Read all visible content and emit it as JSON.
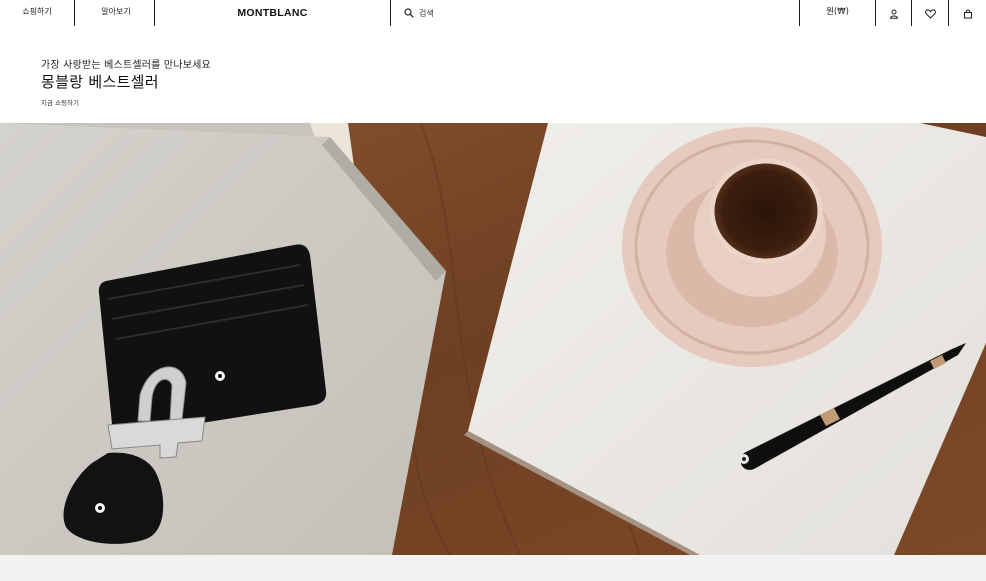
{
  "nav": {
    "shop_label": "쇼핑하기",
    "discover_label": "알아보기",
    "logo_text": "MONTBLANC",
    "search_label": "검색",
    "currency_label": "원(₩)",
    "icons": [
      "user-icon",
      "heart-icon",
      "bag-icon"
    ]
  },
  "hero": {
    "eyebrow": "가장 사랑받는 베스트셀러를 만나보세요",
    "title": "몽블랑 베스트셀러",
    "cta": "지금 쇼핑하기"
  },
  "colors": {
    "text": "#111111",
    "nav_divider": "#1a1a1a",
    "wood": "#7a4a2a",
    "footer_strip": "#f2f2f2"
  }
}
